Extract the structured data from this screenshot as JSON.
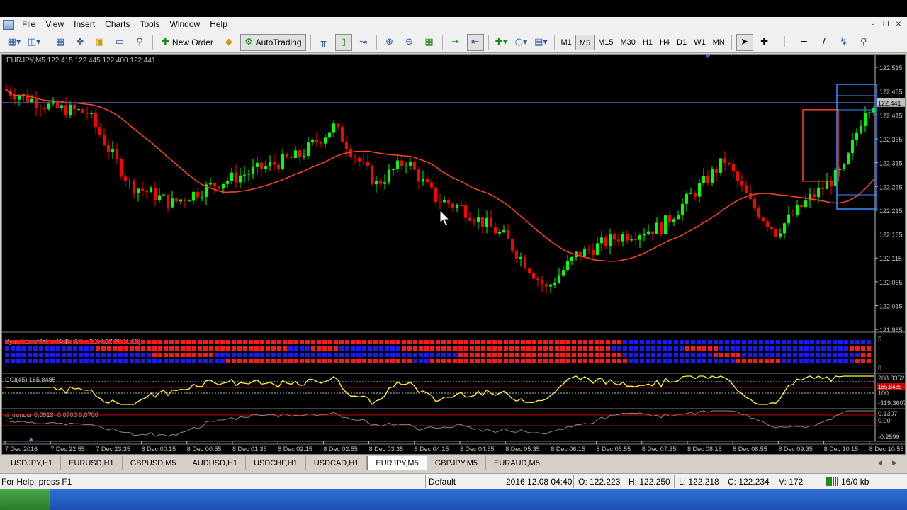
{
  "menu": [
    "File",
    "View",
    "Insert",
    "Charts",
    "Tools",
    "Window",
    "Help"
  ],
  "toolbar": {
    "new_order": "New Order",
    "autotrading": "AutoTrading",
    "timeframes": [
      "M1",
      "M5",
      "M15",
      "M30",
      "H1",
      "H4",
      "D1",
      "W1",
      "MN"
    ],
    "active_timeframe": "M5"
  },
  "chart": {
    "header": "EURJPY,M5  122.415 122.445 122.400 122.441",
    "current_price": "122.441",
    "price_ticks": [
      "122.515",
      "122.465",
      "122.415",
      "122.365",
      "122.315",
      "122.265",
      "122.215",
      "122.165",
      "122.115",
      "122.065",
      "122.015",
      "121.965"
    ],
    "time_ticks": [
      "7 Dec 2016",
      "7 Dec 22:55",
      "7 Dec 23:35",
      "8 Dec 00:15",
      "8 Dec 00:55",
      "8 Dec 01:35",
      "8 Dec 02:15",
      "8 Dec 02:55",
      "8 Dec 03:35",
      "8 Dec 04:15",
      "8 Dec 04:55",
      "8 Dec 05:35",
      "8 Dec 06:15",
      "8 Dec 06:55",
      "8 Dec 07:35",
      "8 Dec 08:15",
      "8 Dec 08:55",
      "8 Dec 09:35",
      "8 Dec 10:15",
      "8 Dec 10:55"
    ],
    "colors": {
      "background": "#000000",
      "bull": "#00ff00",
      "bear": "#ff0000",
      "ma": "#ff4422",
      "grid_text": "#c0c0c0",
      "price_line": "#4a5fc8"
    }
  },
  "indicators": {
    "symphonie": {
      "label": "SymphonieMatrixV4.4b (M5 - 2016.12.08 11:12)",
      "scale_max": "5",
      "scale_min": "0"
    },
    "cci": {
      "label": "CCI(45) 165.8485",
      "scale_max": "208.8352",
      "current": "165.8485",
      "mid": "100",
      "scale_min": "-319.3607"
    },
    "trender": {
      "label": "ri_trender 0.0918 -0.0700 0.0700",
      "scale_max": "0.1307",
      "mid": "0.00",
      "scale_min": "-0.2599"
    }
  },
  "tabs": [
    "USDJPY,H1",
    "EURUSD,H1",
    "GBPUSD,M5",
    "AUDUSD,H1",
    "USDCHF,H1",
    "USDCAD,H1",
    "EURJPY,M5",
    "GBPJPY,M5",
    "EURAUD,M5"
  ],
  "active_tab": "EURJPY,M5",
  "status": {
    "help": "For Help, press F1",
    "profile": "Default",
    "datetime": "2016.12.08 04:40",
    "open": "O: 122.223",
    "high": "H: 122.250",
    "low": "L: 122.218",
    "close": "C: 122.234",
    "volume": "V: 172",
    "traffic": "16/0 kb"
  }
}
